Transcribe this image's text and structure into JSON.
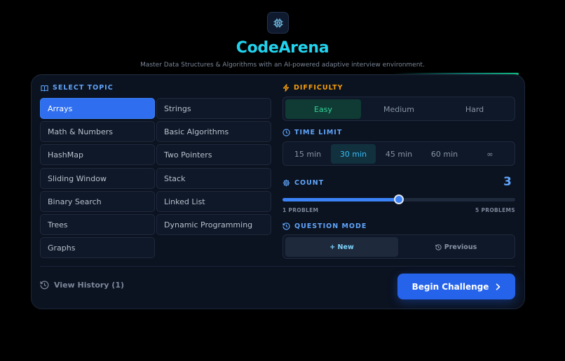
{
  "header": {
    "title": "CodeArena",
    "subtitle": "Master Data Structures & Algorithms with an AI-powered adaptive interview environment.",
    "icon": "cpu-icon"
  },
  "topics": {
    "label": "SELECT TOPIC",
    "selected": "Arrays",
    "left": [
      "Arrays",
      "Math & Numbers",
      "HashMap",
      "Sliding Window",
      "Binary Search",
      "Trees",
      "Graphs"
    ],
    "right": [
      "Strings",
      "Basic Algorithms",
      "Two Pointers",
      "Stack",
      "Linked List",
      "Dynamic Programming"
    ]
  },
  "difficulty": {
    "label": "DIFFICULTY",
    "options": [
      "Easy",
      "Medium",
      "Hard"
    ],
    "selected": "Easy"
  },
  "time_limit": {
    "label": "TIME LIMIT",
    "options": [
      "15 min",
      "30 min",
      "45 min",
      "60 min",
      "∞"
    ],
    "selected": "30 min"
  },
  "count": {
    "label": "COUNT",
    "value": "3",
    "min_label": "1 PROBLEM",
    "max_label": "5 PROBLEMS",
    "min": 1,
    "max": 5,
    "current": 3
  },
  "question_mode": {
    "label": "QUESTION MODE",
    "new_label": "+ New",
    "previous_label": "Previous",
    "selected": "New"
  },
  "footer": {
    "history_label": "View History (1)",
    "begin_label": "Begin Challenge"
  },
  "colors": {
    "accent_blue": "#2f6fef",
    "title_cyan": "#22d3ee",
    "easy_green": "#34d399",
    "difficulty_amber": "#f59e0b"
  }
}
